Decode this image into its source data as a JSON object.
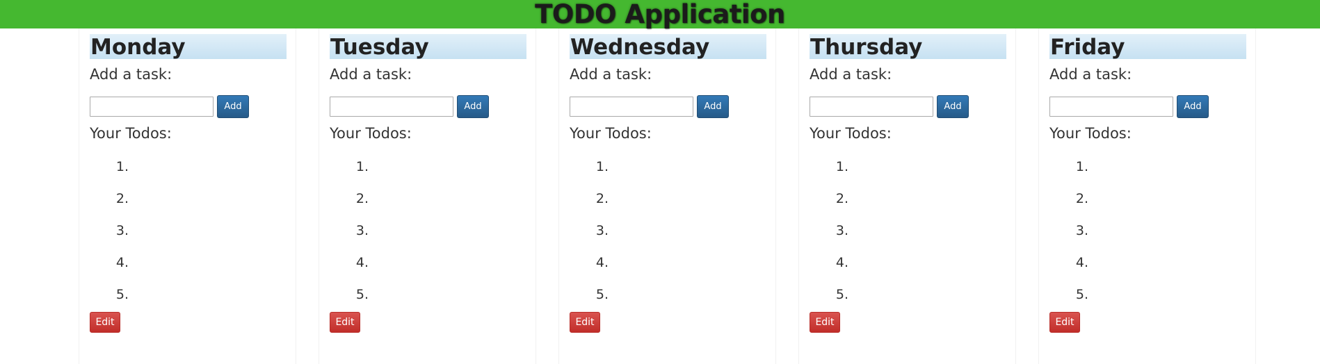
{
  "app": {
    "title": "TODO Application",
    "header_color": "#45b830"
  },
  "labels": {
    "add_task": "Add a task:",
    "your_todos": "Your Todos:",
    "add_button": "Add",
    "edit_button": "Edit"
  },
  "colors": {
    "primary_button": "#337ab7",
    "danger_button": "#d9534f",
    "day_header": "#c6e1f2"
  },
  "days": [
    {
      "name": "Monday",
      "input_value": "",
      "todos": [
        "1.",
        "2.",
        "3.",
        "4.",
        "5."
      ]
    },
    {
      "name": "Tuesday",
      "input_value": "",
      "todos": [
        "1.",
        "2.",
        "3.",
        "4.",
        "5."
      ]
    },
    {
      "name": "Wednesday",
      "input_value": "",
      "todos": [
        "1.",
        "2.",
        "3.",
        "4.",
        "5."
      ]
    },
    {
      "name": "Thursday",
      "input_value": "",
      "todos": [
        "1.",
        "2.",
        "3.",
        "4.",
        "5."
      ]
    },
    {
      "name": "Friday",
      "input_value": "",
      "todos": [
        "1.",
        "2.",
        "3.",
        "4.",
        "5."
      ]
    }
  ]
}
